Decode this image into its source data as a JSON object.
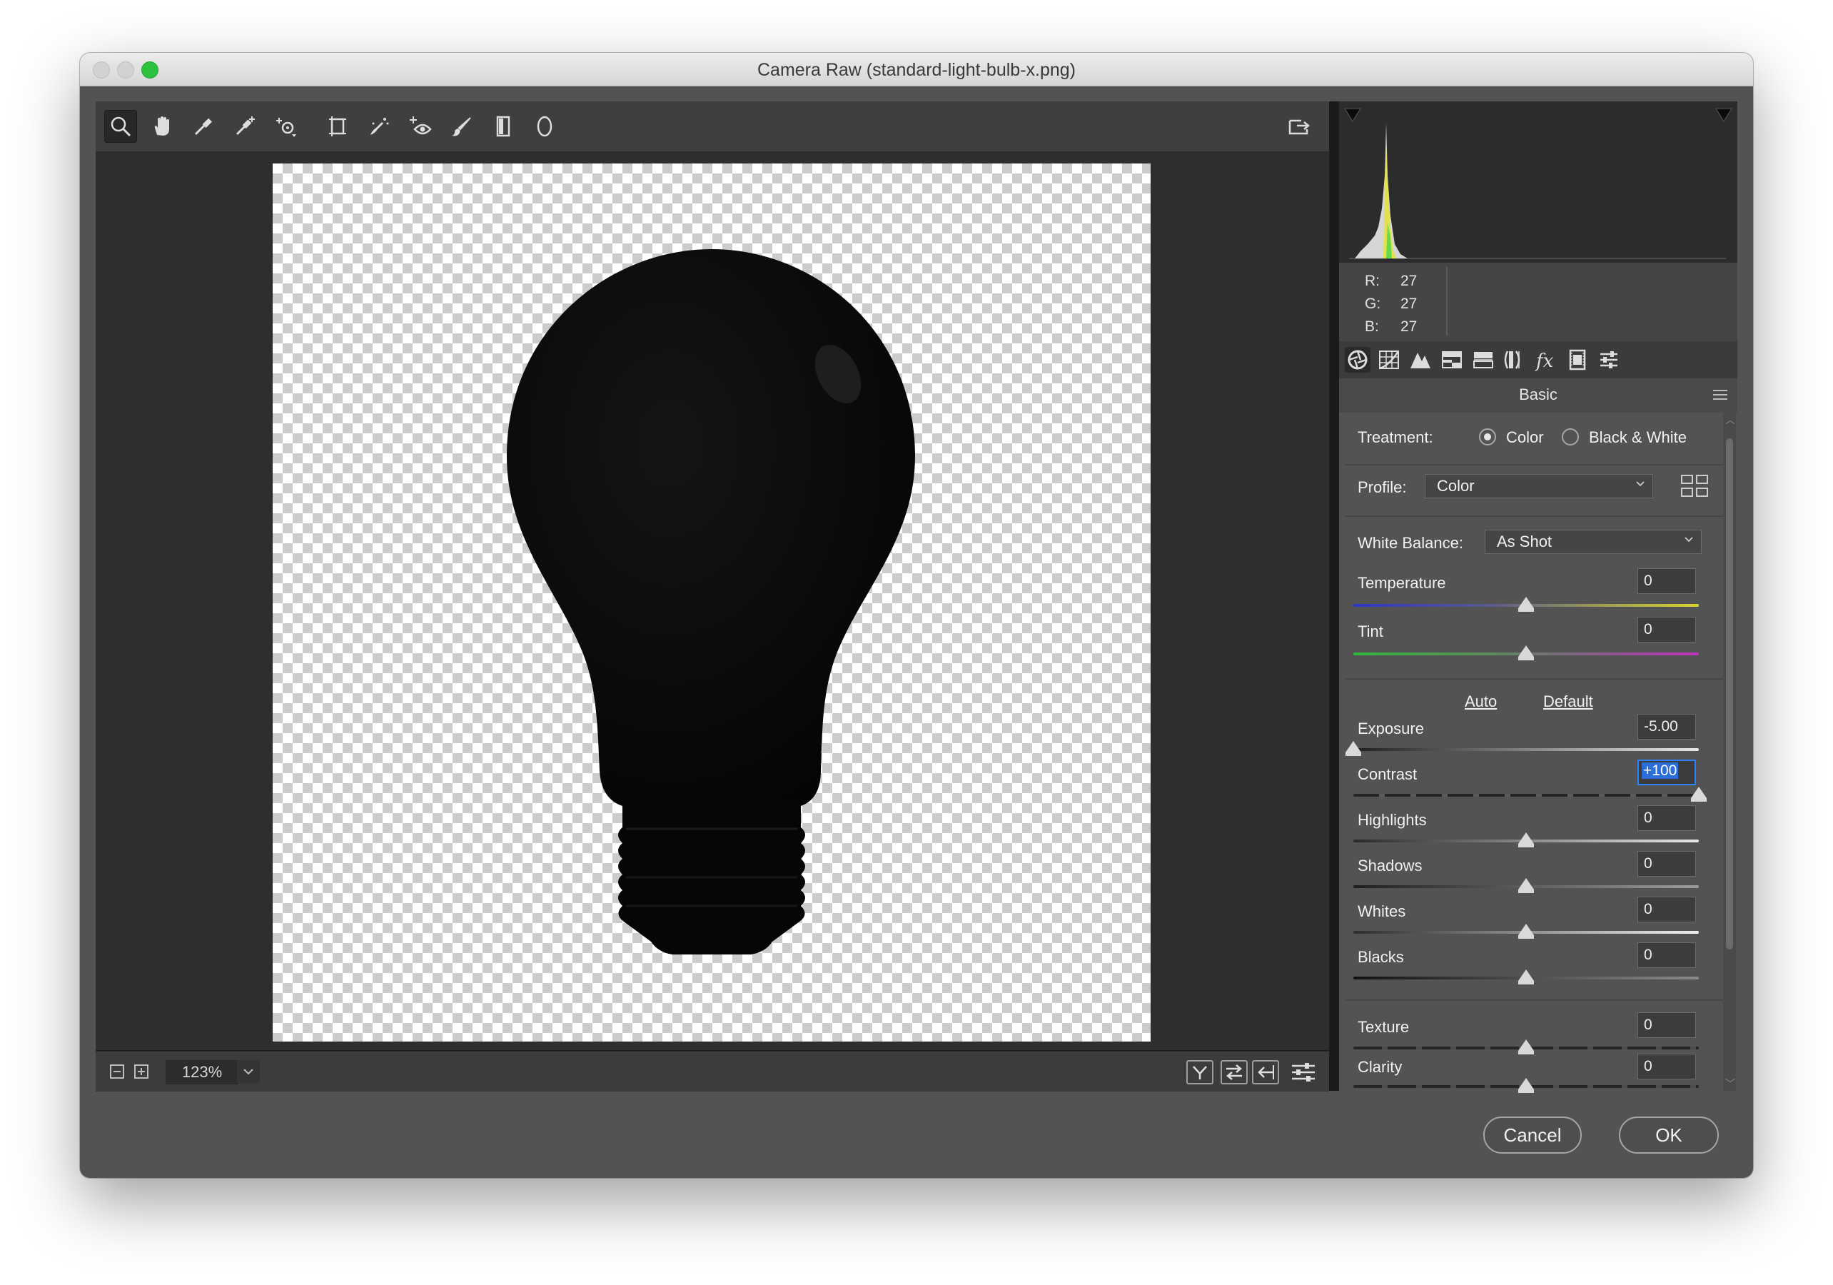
{
  "window": {
    "title": "Camera Raw (standard-light-bulb-x.png)"
  },
  "toolbar": {
    "tools": [
      {
        "name": "zoom-tool",
        "icon": "magnifier-icon",
        "active": true
      },
      {
        "name": "hand-tool",
        "icon": "hand-icon"
      },
      {
        "name": "white-balance-tool",
        "icon": "eyedropper-icon"
      },
      {
        "name": "color-sampler-tool",
        "icon": "color-sampler-icon"
      },
      {
        "name": "targeted-adjustment-tool",
        "icon": "targeted-adjustment-icon"
      },
      {
        "name": "transform-tool",
        "icon": "transform-icon"
      },
      {
        "name": "spot-removal-tool",
        "icon": "spot-removal-icon"
      },
      {
        "name": "red-eye-tool",
        "icon": "red-eye-icon"
      },
      {
        "name": "adjustment-brush-tool",
        "icon": "brush-icon"
      },
      {
        "name": "graduated-filter-tool",
        "icon": "graduated-filter-icon"
      },
      {
        "name": "radial-filter-tool",
        "icon": "radial-filter-icon"
      }
    ],
    "right_icon": "toggle-fullscreen-icon"
  },
  "status": {
    "zoom": "123%"
  },
  "readout": {
    "r_label": "R:",
    "r": "27",
    "g_label": "G:",
    "g": "27",
    "b_label": "B:",
    "b": "27"
  },
  "panel_tabs": [
    "basic-icon",
    "tone-curve-icon",
    "detail-icon",
    "hsl-icon",
    "split-toning-icon",
    "lens-corrections-icon",
    "effects-icon",
    "camera-calibration-icon",
    "presets-icon"
  ],
  "basic": {
    "header": "Basic",
    "treatment_label": "Treatment:",
    "treatment_color": "Color",
    "treatment_bw": "Black & White",
    "treatment_selected": "Color",
    "profile_label": "Profile:",
    "profile_value": "Color",
    "wb_label": "White Balance:",
    "wb_value": "As Shot",
    "auto": "Auto",
    "default": "Default",
    "sliders": [
      {
        "key": "temperature",
        "label": "Temperature",
        "value": "0",
        "pos": 0.5
      },
      {
        "key": "tint",
        "label": "Tint",
        "value": "0",
        "pos": 0.5
      },
      {
        "key": "exposure",
        "label": "Exposure",
        "value": "-5.00",
        "pos": 0.0
      },
      {
        "key": "contrast",
        "label": "Contrast",
        "value": "+100",
        "pos": 1.0
      },
      {
        "key": "highlights",
        "label": "Highlights",
        "value": "0",
        "pos": 0.5
      },
      {
        "key": "shadows",
        "label": "Shadows",
        "value": "0",
        "pos": 0.5
      },
      {
        "key": "whites",
        "label": "Whites",
        "value": "0",
        "pos": 0.5
      },
      {
        "key": "blacks",
        "label": "Blacks",
        "value": "0",
        "pos": 0.5
      },
      {
        "key": "texture",
        "label": "Texture",
        "value": "0",
        "pos": 0.5
      },
      {
        "key": "clarity",
        "label": "Clarity",
        "value": "0",
        "pos": 0.5
      }
    ]
  },
  "buttons": {
    "cancel": "Cancel",
    "ok": "OK"
  }
}
